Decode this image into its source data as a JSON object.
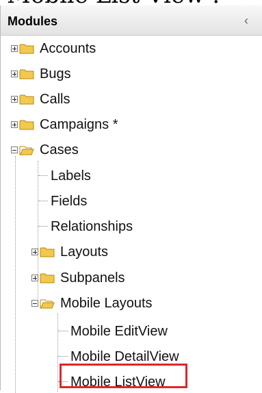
{
  "page_title_fragment": "Mobile List View :",
  "panel": {
    "title": "Modules",
    "collapse_icon": "chevron-left-icon"
  },
  "tree": [
    {
      "label": "Accounts",
      "type": "folder",
      "state": "collapsed"
    },
    {
      "label": "Bugs",
      "type": "folder",
      "state": "collapsed"
    },
    {
      "label": "Calls",
      "type": "folder",
      "state": "collapsed"
    },
    {
      "label": "Campaigns *",
      "type": "folder",
      "state": "collapsed"
    },
    {
      "label": "Cases",
      "type": "folder",
      "state": "expanded"
    },
    {
      "label": "Labels",
      "type": "leaf"
    },
    {
      "label": "Fields",
      "type": "leaf"
    },
    {
      "label": "Relationships",
      "type": "leaf"
    },
    {
      "label": "Layouts",
      "type": "folder",
      "state": "collapsed"
    },
    {
      "label": "Subpanels",
      "type": "folder",
      "state": "collapsed"
    },
    {
      "label": "Mobile Layouts",
      "type": "folder",
      "state": "expanded"
    },
    {
      "label": "Mobile EditView",
      "type": "leaf"
    },
    {
      "label": "Mobile DetailView",
      "type": "leaf"
    },
    {
      "label": "Mobile ListView",
      "type": "leaf",
      "highlighted": true
    }
  ],
  "colors": {
    "highlight": "#e02626",
    "folder_fill": "#f2c94c",
    "folder_stroke": "#b8860b"
  }
}
